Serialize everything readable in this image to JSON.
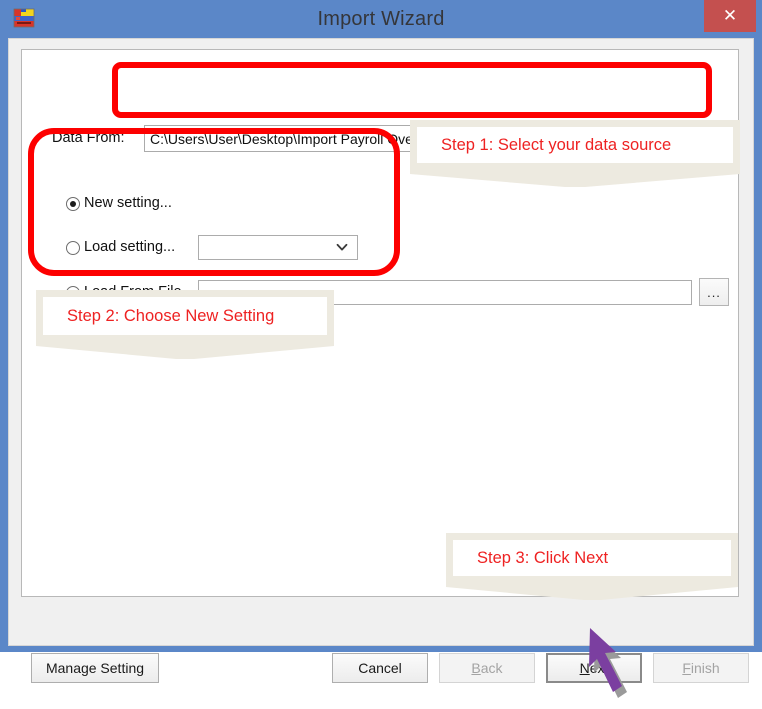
{
  "window": {
    "title": "Import Wizard",
    "icon": "app-icon",
    "close_label": "✕",
    "titlebar_color": "#5b87c8",
    "close_color": "#c4504f"
  },
  "form": {
    "data_from": {
      "label": "Data From:",
      "value": "C:\\Users\\User\\Desktop\\Import Payroll Overtime\\importOT.csv",
      "placeholder": "",
      "browse_label": "..."
    },
    "options": [
      {
        "label": "New setting...",
        "selected": true
      },
      {
        "label": "Load setting...",
        "selected": false
      },
      {
        "label": "Load From File...",
        "selected": false
      }
    ],
    "setting_combo": {
      "value": "",
      "placeholder": "",
      "icon": "chevron-down-icon"
    },
    "load_from_file": {
      "value": "",
      "placeholder": "",
      "browse_label": "..."
    }
  },
  "footer": {
    "manage": {
      "pre": "Manage Settin",
      "accel": "g",
      "post": "",
      "disabled": false
    },
    "cancel": {
      "pre": "Cancel",
      "accel": "",
      "post": "",
      "disabled": false
    },
    "back": {
      "pre": "",
      "accel": "B",
      "post": "ack",
      "disabled": true
    },
    "next": {
      "pre": "",
      "accel": "N",
      "post": "ext",
      "disabled": false
    },
    "finish": {
      "pre": "",
      "accel": "F",
      "post": "inish",
      "disabled": true
    }
  },
  "annotations": {
    "highlight_color": "#fd0000",
    "callout_border_color": "#edeae0",
    "callout_text_color": "#ee2222",
    "cursor_color": "#7b3fa0",
    "callouts": [
      {
        "text": "Step 1: Select your data source"
      },
      {
        "text": "Step 2: Choose New Setting"
      },
      {
        "text": "Step 3: Click Next"
      }
    ]
  }
}
